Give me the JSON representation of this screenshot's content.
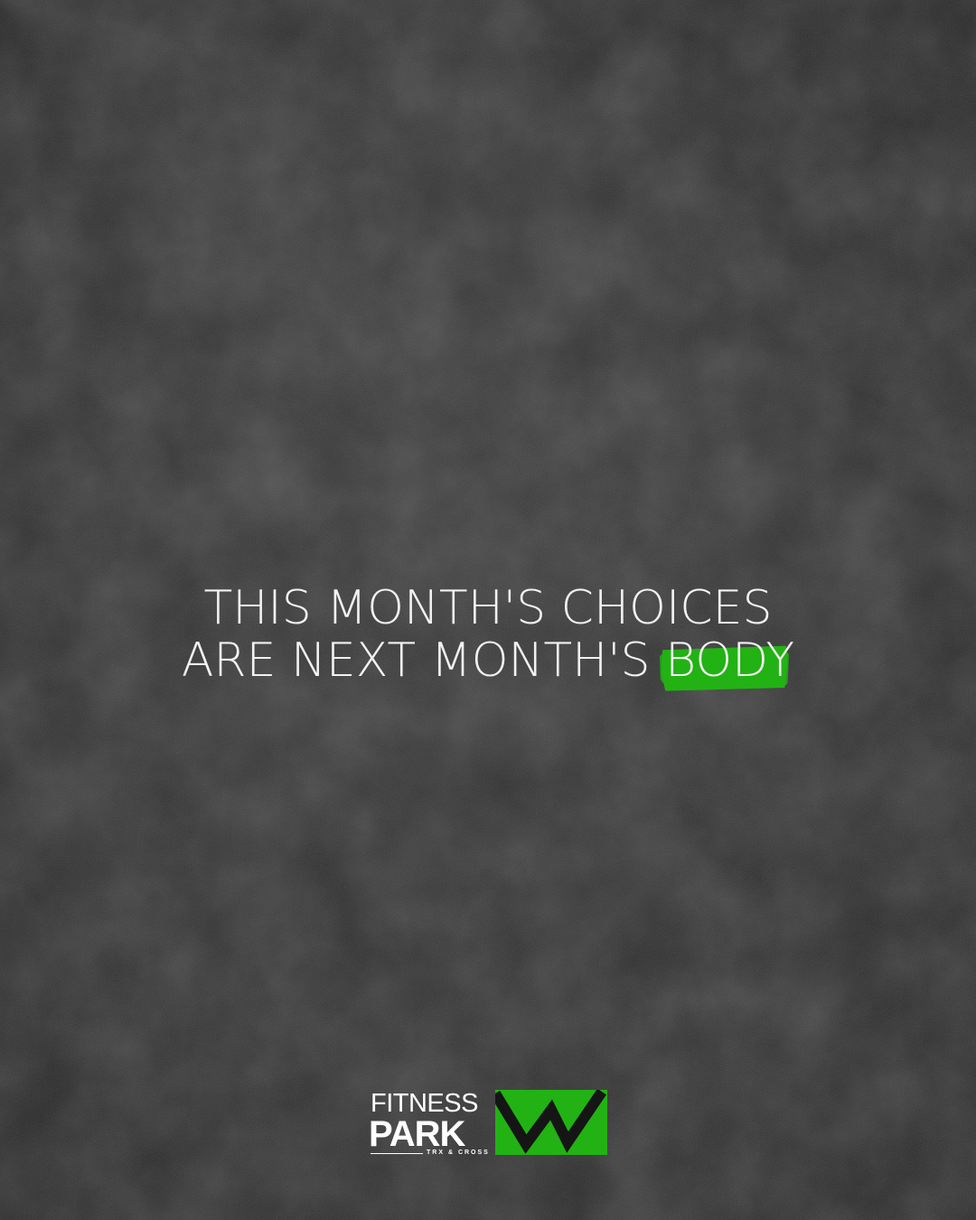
{
  "headline": {
    "line1": "THIS MONTH'S CHOICES",
    "line2_prefix": "ARE NEXT MONTH'S ",
    "highlight_word": "BODY"
  },
  "logo": {
    "line1": "FITNESS",
    "line2": "PARK",
    "tagline": "TRX & CROSS",
    "mark_icon": "green-chevron-w-icon"
  },
  "colors": {
    "background": "#2a2a2a",
    "text": "#f2f2f2",
    "accent": "#22b214"
  }
}
